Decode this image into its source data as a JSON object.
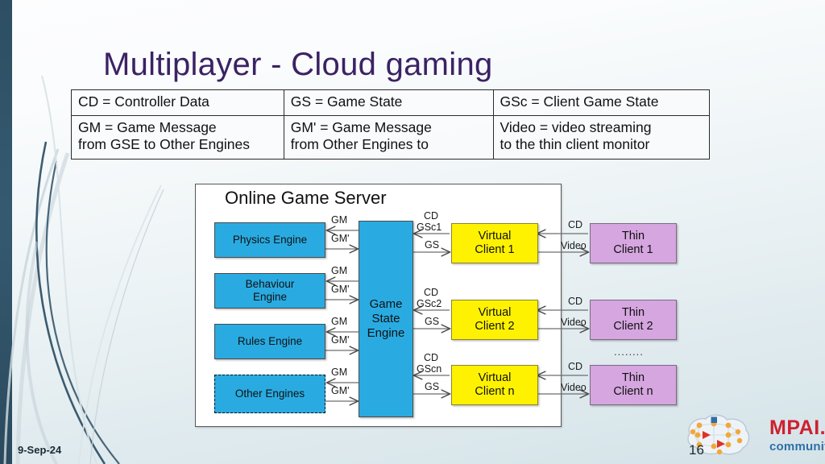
{
  "slide": {
    "title": "Multiplayer  - Cloud gaming",
    "date": "9-Sep-24",
    "page_number": "16",
    "accent_title_color": "#3b2264",
    "left_bar_color": "#2d4e63"
  },
  "legend_table": {
    "rows": [
      [
        "CD = Controller Data",
        "GS = Game State",
        "GSc = Client Game State"
      ],
      [
        "GM = Game Message\nfrom GSE to Other Engines",
        "GM' = Game Message\nfrom Other Engines to",
        "Video = video streaming\nto the thin client monitor"
      ]
    ]
  },
  "diagram": {
    "server_title": "Online Game Server",
    "engines": [
      {
        "label": "Physics Engine",
        "dashed": false
      },
      {
        "label": "Behaviour\nEngine",
        "dashed": false
      },
      {
        "label": "Rules Engine",
        "dashed": false
      },
      {
        "label": "Other Engines",
        "dashed": true
      }
    ],
    "game_state_engine": "Game\nState\nEngine",
    "engine_link_labels": {
      "out": "GM",
      "in": "GM'"
    },
    "virtual_clients": [
      "Virtual\nClient 1",
      "Virtual\nClient 2",
      "Virtual\nClient n"
    ],
    "thin_clients": [
      "Thin\nClient 1",
      "Thin\nClient 2",
      "Thin\nClient n"
    ],
    "gse_client_labels": [
      {
        "cd": "CD",
        "gsc": "GSc1",
        "gs": "GS"
      },
      {
        "cd": "CD",
        "gsc": "GSc2",
        "gs": "GS"
      },
      {
        "cd": "CD",
        "gsc": "GScn",
        "gs": "GS"
      }
    ],
    "client_link_labels": {
      "cd": "CD",
      "video": "Video"
    },
    "ellipsis": "........",
    "colors": {
      "engine_fill": "#29ABE2",
      "virtual_client_fill": "#FFF200",
      "thin_client_fill": "#D6A6E0",
      "server_fill": "#FFFFFF"
    }
  },
  "logo": {
    "name": "MPAI.",
    "tagline": "community"
  }
}
